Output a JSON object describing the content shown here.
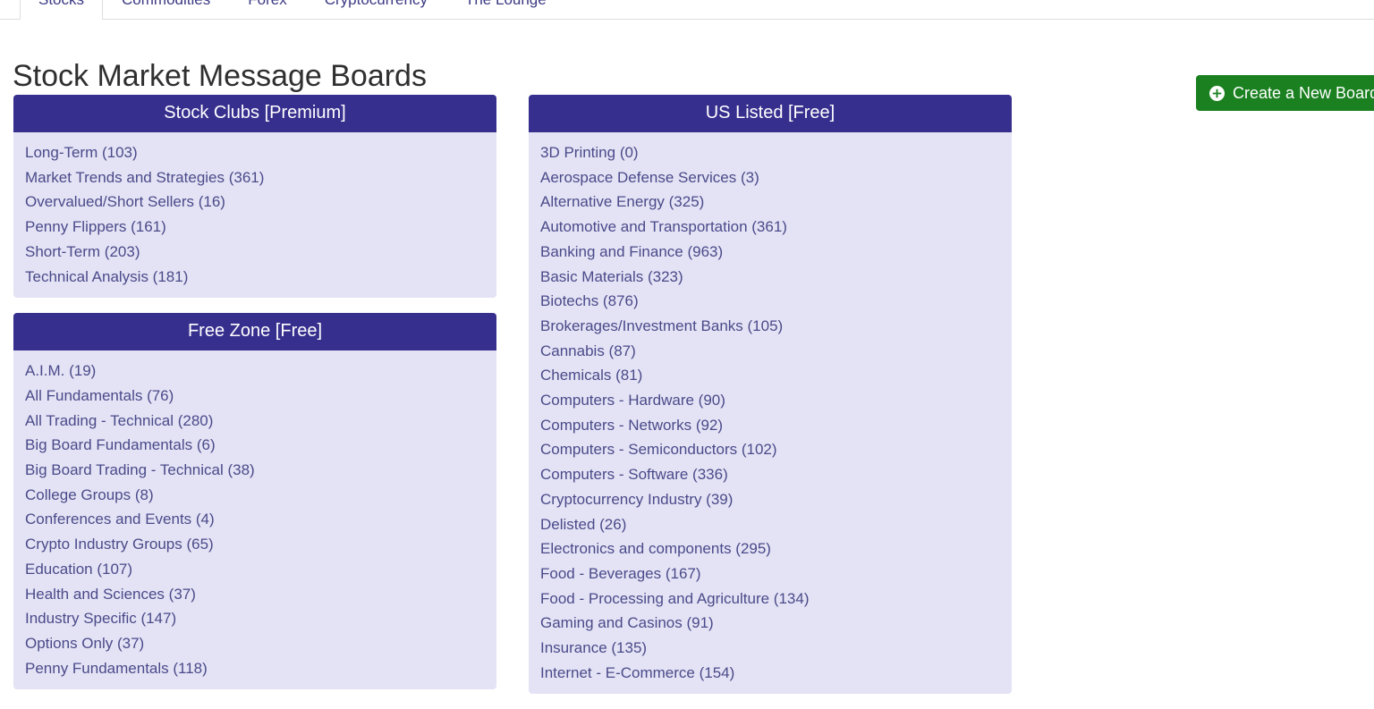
{
  "nav": {
    "tabs": [
      {
        "label": "Stocks",
        "active": true
      },
      {
        "label": "Commodities",
        "active": false
      },
      {
        "label": "Forex",
        "active": false
      },
      {
        "label": "Cryptocurrency",
        "active": false
      },
      {
        "label": "The Lounge",
        "active": false
      }
    ]
  },
  "header": {
    "title": "Stock Market Message Boards",
    "create_button_label": "Create a New Board",
    "create_button_icon": "plus-circle-icon",
    "create_button_color": "#1a8020"
  },
  "theme": {
    "panel_header_bg": "#372f8e",
    "panel_body_bg": "#e4e3f5",
    "link_color": "#4a4a8a",
    "tab_color": "#3c3a84"
  },
  "panels": [
    {
      "title": "Stock Clubs [Premium]",
      "column": "left",
      "items": [
        "Long-Term (103)",
        "Market Trends and Strategies (361)",
        "Overvalued/Short Sellers (16)",
        "Penny Flippers (161)",
        "Short-Term (203)",
        "Technical Analysis (181)"
      ]
    },
    {
      "title": "Free Zone [Free]",
      "column": "left",
      "items": [
        "A.I.M. (19)",
        "All Fundamentals (76)",
        "All Trading - Technical (280)",
        "Big Board Fundamentals (6)",
        "Big Board Trading - Technical (38)",
        "College Groups (8)",
        "Conferences and Events (4)",
        "Crypto Industry Groups (65)",
        "Education (107)",
        "Health and Sciences (37)",
        "Industry Specific (147)",
        "Options Only (37)",
        "Penny Fundamentals (118)"
      ]
    },
    {
      "title": "US Listed [Free]",
      "column": "right",
      "items": [
        "3D Printing (0)",
        "Aerospace Defense Services (3)",
        "Alternative Energy (325)",
        "Automotive and Transportation (361)",
        "Banking and Finance (963)",
        "Basic Materials (323)",
        "Biotechs (876)",
        "Brokerages/Investment Banks (105)",
        "Cannabis (87)",
        "Chemicals (81)",
        "Computers - Hardware (90)",
        "Computers - Networks (92)",
        "Computers - Semiconductors (102)",
        "Computers - Software (336)",
        "Cryptocurrency Industry (39)",
        "Delisted (26)",
        "Electronics and components (295)",
        "Food - Beverages (167)",
        "Food - Processing and Agriculture (134)",
        "Gaming and Casinos (91)",
        "Insurance (135)",
        "Internet - E-Commerce (154)"
      ]
    }
  ]
}
